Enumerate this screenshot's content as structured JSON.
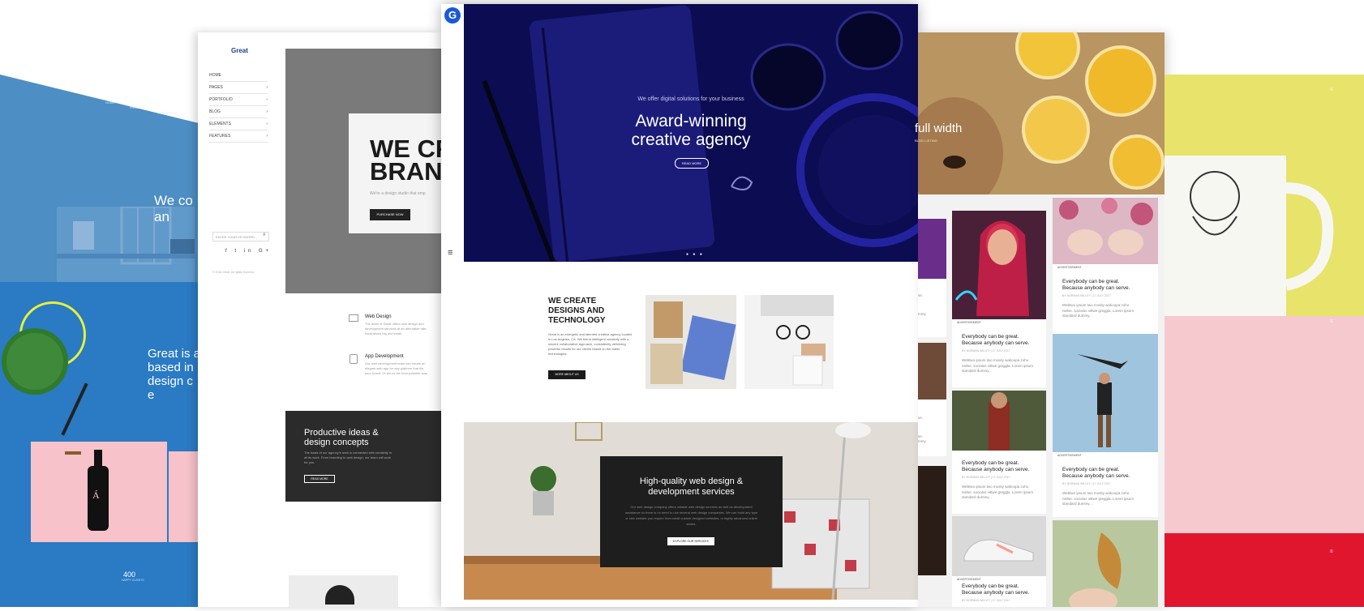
{
  "left_page": {
    "nav": [
      "HOME",
      "PAGES",
      "PORTFOLIO"
    ],
    "headline": "We co\nan",
    "intro": "Great is a\nbased in\ndesign c\ne",
    "stat_value": "400",
    "stat_label": "HAPPY CLIENTS"
  },
  "left_center_page": {
    "logo": "Great",
    "menu": [
      "HOME",
      "PAGES",
      "PORTFOLIO",
      "BLOG",
      "ELEMENTS",
      "FEATURES"
    ],
    "hero_heading": "WE CR\nBRAN",
    "hero_text": "We're a design studio that emp",
    "hero_button": "PURCHASE NOW",
    "search_placeholder": "ENTER YOUR KEYWORD...",
    "social": "f  t  in  G+",
    "copyright": "© 2018 Great. All rights reserved.",
    "services": [
      {
        "title": "Web Design",
        "text": "The team of Great offers web design and development services at an affordable rate. Illustrations big and small."
      },
      {
        "title": "App Development",
        "text": "Our web development team can create an elegant web app for any platform that fits your brand. Or tell us the best possible way."
      }
    ],
    "promo_title": "Productive ideas & design concepts",
    "promo_text": "The basis of our agency's work is connected with creativity in all its work. From branding to web design, our team will work for you.",
    "promo_button": "READ MORE"
  },
  "main_page": {
    "logo_letter": "G",
    "hero_pretitle": "We offer digital solutions for your business",
    "hero_title": "Award-winning\ncreative agency",
    "hero_button": "READ MORE",
    "slider_dots": "● ● ●",
    "about_title": "WE CREATE\nDESIGNS AND\nTECHNOLOGY",
    "about_text": "Great is an energetic and talented creative agency located in Los Angeles, CA. We blend intelligent creativity with a sincere collaborative approach, consistently delivering powerful results for our clients based on the latest technologies.",
    "about_button": "MORE ABOUT US",
    "services_title": "High-quality web design &\ndevelopment services",
    "services_text": "Our web design company offers reliable web design services as well as development assistance so there is no need to use several web design companies. We can build any type or size website you require from small custom designed websites, or highly advanced online stores.",
    "services_button": "EXPLORE OUR SERVICES"
  },
  "right_page": {
    "hero_title": "full width",
    "hero_subtitle": "BLOG LISTING",
    "posts": [
      {
        "category": "ADVERTISEMENT",
        "title": "Everybody can be great. Because anybody can serve.",
        "meta": "BY NORMAN WILLEY  |  17 JULY 2017",
        "text": "Webtwo ipsum two mosity wakoopa zoho nielse. socialos vittwe greggla. Lorem ipsum standard dummy..."
      },
      {
        "category": "ADVERTISEMENT",
        "title": "Everybody can be great. Because anybody can serve.",
        "meta": "BY NORMAN WILLEY  |  17 JULY 2017",
        "text": "Webtwo ipsum two mosity wakoopa zoho nielse. socialos vittwe greggla. Lorem ipsum standard dummy..."
      },
      {
        "category": "ADVERTISEMENT",
        "title": "Everybody can be great. Because anybody can serve.",
        "meta": "BY NORMAN WILLEY  |  17 JULY 2017",
        "text": "Webtwo ipsum two mosity wakoopa zoho nielse. socialos vittwe greggla. Lorem ipsum standard dummy..."
      },
      {
        "category": "ADVERTISEMENT",
        "title": "Everybody can be great. Because anybody can serve.",
        "meta": "BY NORMAN WILLEY  |  17 JULY 2017",
        "text": "Webtwo ipsum two mosity wakoopa zoho nielse. socialos vittwe greggla. Lorem ipsum standard dummy..."
      },
      {
        "category": "ADVERTISEMENT",
        "title": "Everybody can be great. Because anybody can serve.",
        "meta": "BY NORMAN WILLEY  |  17 JULY 2017",
        "text": ""
      }
    ],
    "side_snippets": [
      "se.",
      "mmy",
      "ve.",
      "se.",
      "mmy"
    ]
  },
  "colors": {
    "hero_navy": "#0c0c52",
    "brand_blue": "#1a5ad8",
    "left_blue": "#2a7ac4",
    "yellow": "#e8e36a",
    "pink": "#f6c9ce",
    "red": "#e0162f"
  }
}
